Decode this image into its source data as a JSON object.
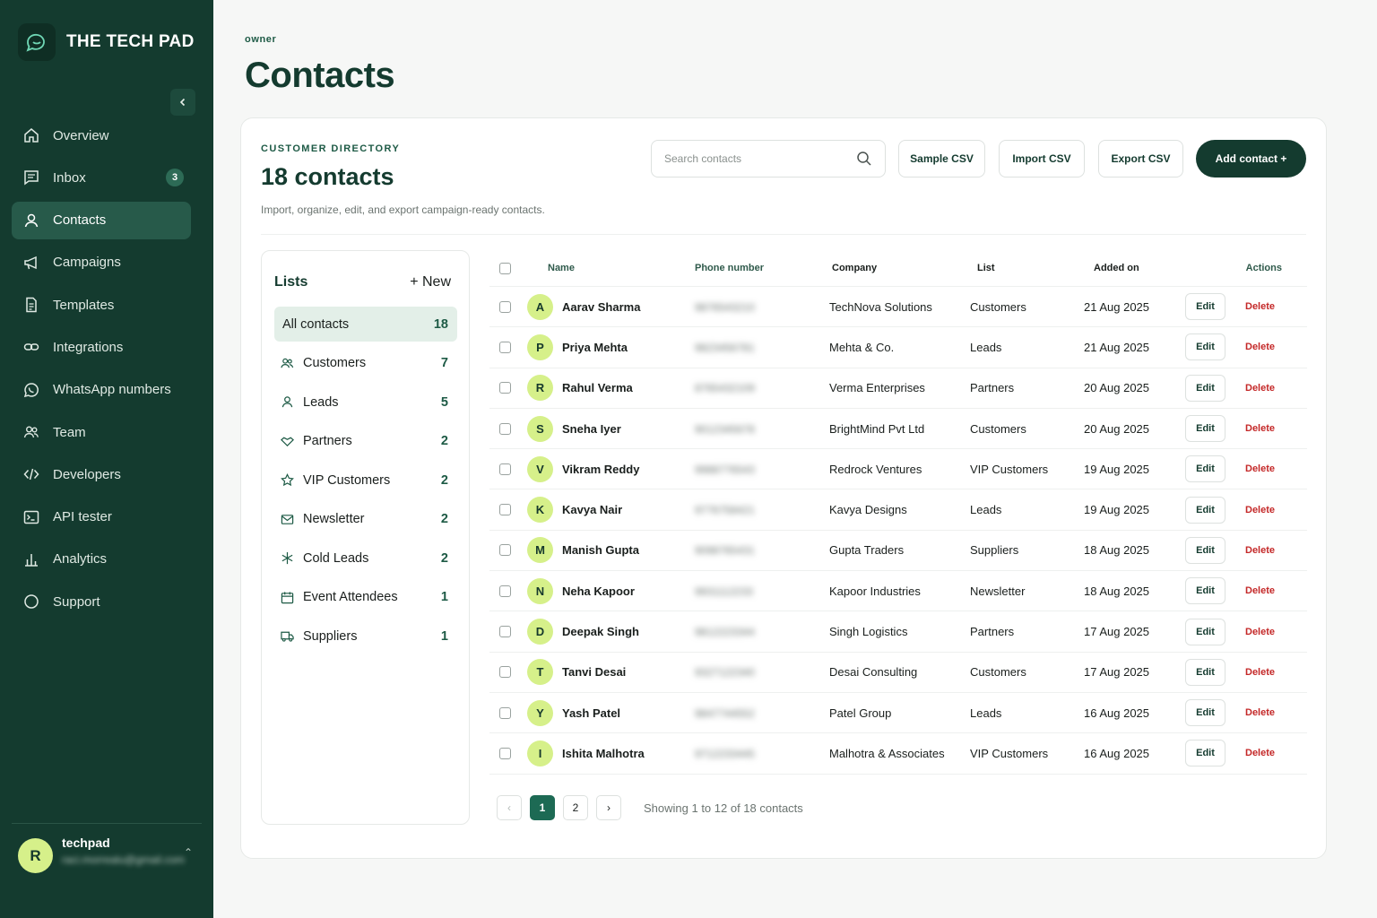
{
  "brand": {
    "name": "THE TECH PAD"
  },
  "sidebar": {
    "items": [
      {
        "label": "Overview",
        "icon": "home-icon"
      },
      {
        "label": "Inbox",
        "icon": "inbox-icon",
        "badge": "3"
      },
      {
        "label": "Contacts",
        "icon": "user-icon",
        "active": true
      },
      {
        "label": "Campaigns",
        "icon": "megaphone-icon"
      },
      {
        "label": "Templates",
        "icon": "document-icon"
      },
      {
        "label": "Integrations",
        "icon": "link-icon"
      },
      {
        "label": "WhatsApp numbers",
        "icon": "whatsapp-icon"
      },
      {
        "label": "Team",
        "icon": "team-icon"
      },
      {
        "label": "Developers",
        "icon": "code-icon"
      },
      {
        "label": "API tester",
        "icon": "terminal-icon"
      },
      {
        "label": "Analytics",
        "icon": "bar-chart-icon"
      },
      {
        "label": "Support",
        "icon": "circle-icon"
      }
    ],
    "user": {
      "initial": "R",
      "name": "techpad",
      "email": "raci.morrealu@gmail.com"
    }
  },
  "page": {
    "role": "owner",
    "title": "Contacts"
  },
  "directory": {
    "eyebrow": "CUSTOMER DIRECTORY",
    "heading": "18 contacts",
    "subtitle": "Import, organize, edit, and export campaign-ready contacts.",
    "search_placeholder": "Search contacts",
    "buttons": {
      "sample": "Sample CSV",
      "import": "Import CSV",
      "export": "Export CSV",
      "add": "Add contact +"
    }
  },
  "lists": {
    "title": "Lists",
    "new_label": "+ New",
    "items": [
      {
        "label": "All contacts",
        "count": "18",
        "active": true,
        "icon": ""
      },
      {
        "label": "Customers",
        "count": "7",
        "icon": "users-icon"
      },
      {
        "label": "Leads",
        "count": "5",
        "icon": "user-icon"
      },
      {
        "label": "Partners",
        "count": "2",
        "icon": "handshake-icon"
      },
      {
        "label": "VIP Customers",
        "count": "2",
        "icon": "star-icon"
      },
      {
        "label": "Newsletter",
        "count": "2",
        "icon": "mail-icon"
      },
      {
        "label": "Cold Leads",
        "count": "2",
        "icon": "snowflake-icon"
      },
      {
        "label": "Event Attendees",
        "count": "1",
        "icon": "calendar-icon"
      },
      {
        "label": "Suppliers",
        "count": "1",
        "icon": "truck-icon"
      }
    ]
  },
  "table": {
    "headers": {
      "name": "Name",
      "phone": "Phone number",
      "company": "Company",
      "list": "List",
      "added": "Added on",
      "actions": "Actions"
    },
    "edit_label": "Edit",
    "delete_label": "Delete",
    "rows": [
      {
        "initial": "A",
        "name": "Aarav Sharma",
        "phone": "9876543210",
        "company": "TechNova Solutions",
        "list": "Customers",
        "added": "21 Aug 2025"
      },
      {
        "initial": "P",
        "name": "Priya Mehta",
        "phone": "9823456781",
        "company": "Mehta & Co.",
        "list": "Leads",
        "added": "21 Aug 2025"
      },
      {
        "initial": "R",
        "name": "Rahul Verma",
        "phone": "8765432109",
        "company": "Verma Enterprises",
        "list": "Partners",
        "added": "20 Aug 2025"
      },
      {
        "initial": "S",
        "name": "Sneha Iyer",
        "phone": "9012345678",
        "company": "BrightMind Pvt Ltd",
        "list": "Customers",
        "added": "20 Aug 2025"
      },
      {
        "initial": "V",
        "name": "Vikram Reddy",
        "phone": "9988776543",
        "company": "Redrock Ventures",
        "list": "VIP Customers",
        "added": "19 Aug 2025"
      },
      {
        "initial": "K",
        "name": "Kavya Nair",
        "phone": "9776758421",
        "company": "Kavya Designs",
        "list": "Leads",
        "added": "19 Aug 2025"
      },
      {
        "initial": "M",
        "name": "Manish Gupta",
        "phone": "9098765431",
        "company": "Gupta Traders",
        "list": "Suppliers",
        "added": "18 Aug 2025"
      },
      {
        "initial": "N",
        "name": "Neha Kapoor",
        "phone": "9931112233",
        "company": "Kapoor Industries",
        "list": "Newsletter",
        "added": "18 Aug 2025"
      },
      {
        "initial": "D",
        "name": "Deepak Singh",
        "phone": "9812223344",
        "company": "Singh Logistics",
        "list": "Partners",
        "added": "17 Aug 2025"
      },
      {
        "initial": "T",
        "name": "Tanvi Desai",
        "phone": "9327122340",
        "company": "Desai Consulting",
        "list": "Customers",
        "added": "17 Aug 2025"
      },
      {
        "initial": "Y",
        "name": "Yash Patel",
        "phone": "9847744552",
        "company": "Patel Group",
        "list": "Leads",
        "added": "16 Aug 2025"
      },
      {
        "initial": "I",
        "name": "Ishita Malhotra",
        "phone": "9712233445",
        "company": "Malhotra & Associates",
        "list": "VIP Customers",
        "added": "16 Aug 2025"
      }
    ]
  },
  "pagination": {
    "pages": [
      "1",
      "2"
    ],
    "current": "1",
    "info": "Showing 1 to 12 of 18 contacts"
  },
  "colors": {
    "sidebar": "#143b2f",
    "accent": "#1d6a54",
    "avatar": "#d6f08a",
    "delete": "#c42828"
  }
}
